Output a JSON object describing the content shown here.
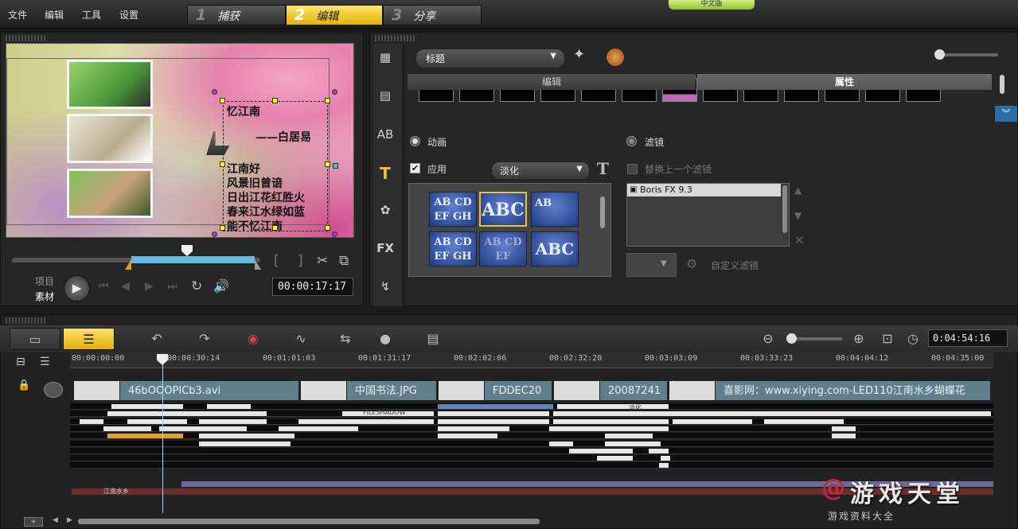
{
  "menu": [
    "文件",
    "编辑",
    "工具",
    "设置"
  ],
  "steps": [
    {
      "num": "1",
      "label": "捕获"
    },
    {
      "num": "2",
      "label": "编辑"
    },
    {
      "num": "3",
      "label": "分享"
    }
  ],
  "brand_tab": "中文版",
  "preview": {
    "poem": [
      "忆江南",
      "——白居易",
      "江南好",
      "风景旧曾谙",
      "日出江花红胜火",
      "春来江水绿如蓝",
      "能不忆江南"
    ],
    "mode_project": "项目",
    "mode_clip": "素材",
    "timecode": "00:00:17:17",
    "mark_in": "[",
    "mark_out": "]"
  },
  "library": {
    "category": "标题",
    "subtabs": {
      "edit": "编辑",
      "attributes": "属性"
    },
    "animation_label": "动画",
    "apply_label": "应用",
    "effect_select": "淡化",
    "filter_label": "滤镜",
    "replace_filter_label": "替换上一个滤镜",
    "filter_list": [
      "Boris FX 9.3"
    ],
    "custom_filter_label": "自定义滤镜",
    "presets": [
      "AB CD EF GH",
      "ABC",
      "AB",
      "AB CD EF GH",
      "AB CD EF",
      "ABC"
    ]
  },
  "timeline": {
    "timecode": "0:04:54:16",
    "ruler": [
      "00:00:00:00",
      "00:00:30:14",
      "00:01:01:03",
      "00:01:31:17",
      "00:02:02:06",
      "00:02:32:20",
      "00:03:03:09",
      "00:03:33:23",
      "00:04:04:12",
      "00:04:35:00"
    ],
    "clips": [
      "46bOOOPICb3.avi",
      "中国书法.JPG",
      "FDDEC20",
      "20087241",
      "喜影网：www.xiying.com-LED110江南水乡蝴蝶花"
    ],
    "title_track_text": "FILESHADOW",
    "effect_text": "淡化",
    "audio_track_text": "江南水乡"
  },
  "watermark": {
    "main": "游戏天堂",
    "sub": "游戏资料大全"
  },
  "colors": {
    "accent": "#e8b81a",
    "clip": "#5f7f8c",
    "selection": "#f0c030"
  }
}
